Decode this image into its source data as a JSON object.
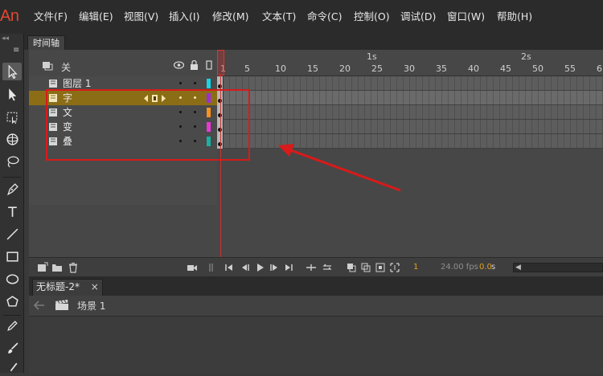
{
  "app": {
    "logo": "An"
  },
  "menu": [
    "文件(F)",
    "编辑(E)",
    "视图(V)",
    "插入(I)",
    "修改(M)",
    "文本(T)",
    "命令(C)",
    "控制(O)",
    "调试(D)",
    "窗口(W)",
    "帮助(H)"
  ],
  "toolbar": {
    "grip": "◂◂",
    "menu_glyph": "≡",
    "tools": [
      "selection-tool",
      "subselection-tool",
      "free-transform-tool",
      "3d-rotation-tool",
      "lasso-tool",
      "pen-tool",
      "text-tool",
      "line-tool",
      "rectangle-tool",
      "oval-tool",
      "polystar-tool",
      "pencil-tool",
      "brush-tool",
      "paint-brush-tool"
    ]
  },
  "timeline": {
    "tab_label": "时间轴",
    "header_label": "关",
    "ruler": {
      "frame_labels": [
        "1",
        "5",
        "10",
        "15",
        "20",
        "25",
        "30",
        "35",
        "40",
        "45",
        "50",
        "55",
        "6"
      ],
      "second_labels": [
        "1s",
        "2s"
      ]
    },
    "layers": [
      {
        "name": "图层 1",
        "color": "#19d3e6",
        "selected": false,
        "show_controls": false
      },
      {
        "name": "字",
        "color": "#9b30d6",
        "selected": true,
        "show_controls": true
      },
      {
        "name": "文",
        "color": "#f7931e",
        "selected": false,
        "show_controls": false
      },
      {
        "name": "变",
        "color": "#ea37d8",
        "selected": false,
        "show_controls": false
      },
      {
        "name": "叠",
        "color": "#1ab0a3",
        "selected": false,
        "show_controls": false
      }
    ],
    "footer": {
      "current_frame": "1",
      "fps": "24.00 fps",
      "time": "0.0",
      "time_unit": "s"
    }
  },
  "document": {
    "tab_label": "无标题-2*",
    "close_glyph": "×",
    "scene_label": "场景 1"
  },
  "colors": {
    "annotation": "#d81a1a",
    "playhead": "#c93333",
    "selected_layer": "#8b6d16",
    "logo": "#e0492f",
    "frame_number": "#e0a020"
  }
}
